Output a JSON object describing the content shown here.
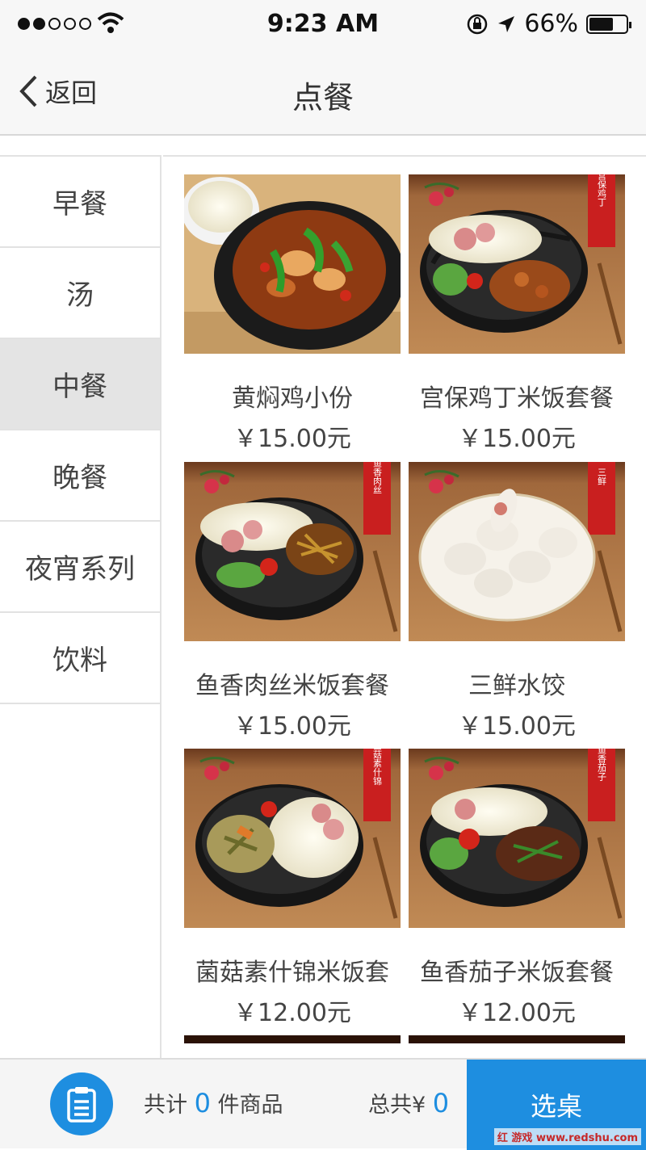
{
  "status_bar": {
    "time": "9:23 AM",
    "battery": "66%",
    "battery_level": 0.66
  },
  "nav": {
    "back_label": "返回",
    "title": "点餐"
  },
  "categories": [
    {
      "label": "早餐",
      "active": false
    },
    {
      "label": "汤",
      "active": false
    },
    {
      "label": "中餐",
      "active": true
    },
    {
      "label": "晚餐",
      "active": false
    },
    {
      "label": "夜宵系列",
      "active": false
    },
    {
      "label": "饮料",
      "active": false
    }
  ],
  "menu_items": [
    {
      "name": "黄焖鸡小份",
      "price": "￥15.00元",
      "card_label": ""
    },
    {
      "name": "宫保鸡丁米饭套餐",
      "price": "￥15.00元",
      "card_label": "宫保鸡丁"
    },
    {
      "name": "鱼香肉丝米饭套餐",
      "price": "￥15.00元",
      "card_label": "鱼香肉丝"
    },
    {
      "name": "三鲜水饺",
      "price": "￥15.00元",
      "card_label": "三鲜"
    },
    {
      "name": "菌菇素什锦米饭套",
      "price": "￥12.00元",
      "card_label": "菌菇素什锦"
    },
    {
      "name": "鱼香茄子米饭套餐",
      "price": "￥12.00元",
      "card_label": "鱼香茄子"
    }
  ],
  "cart": {
    "count_prefix": "共计",
    "count": "0",
    "count_suffix": "件商品",
    "total_prefix": "总共¥",
    "total": "0",
    "select_label": "选桌"
  },
  "watermark": "红 游戏 www.redshu.com",
  "colors": {
    "accent": "#1e8ee0",
    "nav_bg": "#f7f7f7",
    "active_category_bg": "#e4e4e4"
  }
}
